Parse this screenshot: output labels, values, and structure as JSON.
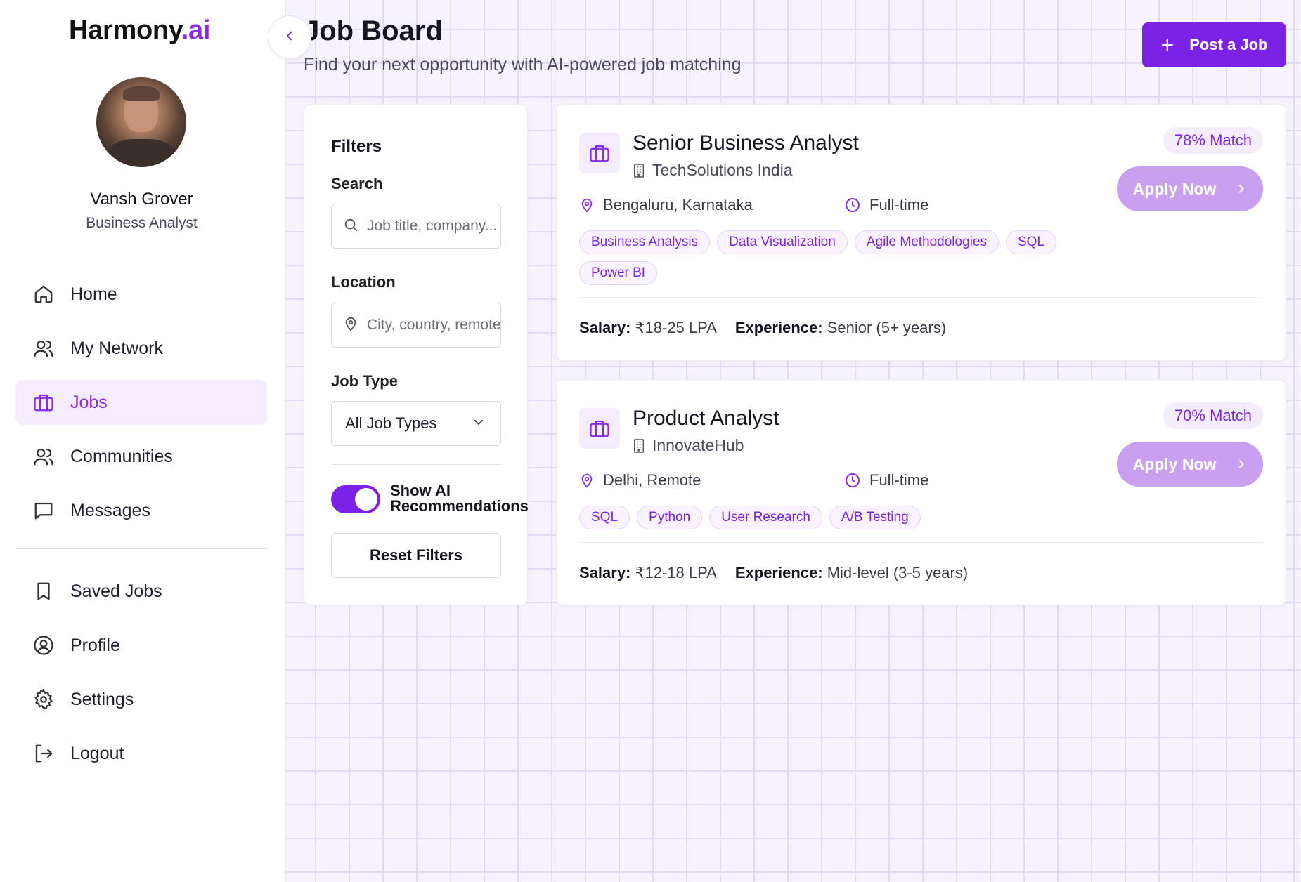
{
  "brand": {
    "name": "Harmony",
    "suffix": ".ai"
  },
  "user": {
    "name": "Vansh Grover",
    "role": "Business Analyst"
  },
  "nav": [
    {
      "label": "Home",
      "icon": "home-icon",
      "active": false
    },
    {
      "label": "My Network",
      "icon": "users-icon",
      "active": false
    },
    {
      "label": "Jobs",
      "icon": "briefcase-icon",
      "active": true
    },
    {
      "label": "Communities",
      "icon": "users-icon",
      "active": false
    },
    {
      "label": "Messages",
      "icon": "message-icon",
      "active": false
    }
  ],
  "nav2": [
    {
      "label": "Saved Jobs",
      "icon": "bookmark-icon"
    },
    {
      "label": "Profile",
      "icon": "user-circle-icon"
    },
    {
      "label": "Settings",
      "icon": "gear-icon"
    },
    {
      "label": "Logout",
      "icon": "logout-icon"
    }
  ],
  "header": {
    "title": "Job Board",
    "subtitle": "Find your next opportunity with AI-powered job matching",
    "post_button": "Post a Job"
  },
  "filters": {
    "title": "Filters",
    "search_label": "Search",
    "search_placeholder": "Job title, company...",
    "location_label": "Location",
    "location_placeholder": "City, country, remote...",
    "job_type_label": "Job Type",
    "job_type_value": "All Job Types",
    "ai_toggle_label": "Show AI Recommendations",
    "ai_toggle_on": true,
    "reset_label": "Reset Filters"
  },
  "jobs": [
    {
      "title": "Senior Business Analyst",
      "company": "TechSolutions India",
      "match": "78% Match",
      "apply_label": "Apply Now",
      "location": "Bengaluru, Karnataka",
      "type": "Full-time",
      "tags": [
        "Business Analysis",
        "Data Visualization",
        "Agile Methodologies",
        "SQL",
        "Power BI"
      ],
      "salary_label": "Salary:",
      "salary": "₹18-25 LPA",
      "experience_label": "Experience:",
      "experience": "Senior (5+ years)"
    },
    {
      "title": "Product Analyst",
      "company": "InnovateHub",
      "match": "70% Match",
      "apply_label": "Apply Now",
      "location": "Delhi, Remote",
      "type": "Full-time",
      "tags": [
        "SQL",
        "Python",
        "User Research",
        "A/B Testing"
      ],
      "salary_label": "Salary:",
      "salary": "₹12-18 LPA",
      "experience_label": "Experience:",
      "experience": "Mid-level (3-5 years)"
    }
  ],
  "colors": {
    "accent": "#7c22e6",
    "accent_light": "#f3ecfd",
    "apply_button": "#c99ff0"
  }
}
